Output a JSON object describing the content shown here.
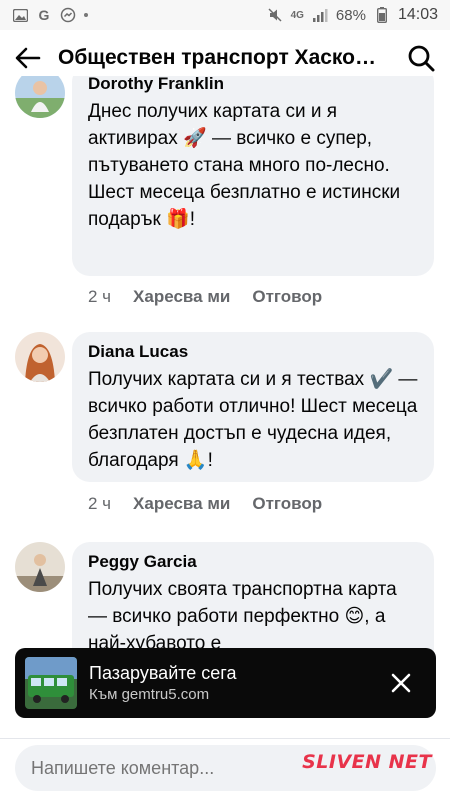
{
  "status_bar": {
    "battery": "68%",
    "time": "14:03",
    "network": "4G"
  },
  "header": {
    "title": "Обществен транспорт Хаско…"
  },
  "comments": [
    {
      "author": "Dorothy Franklin",
      "text": "Днес получих картата си и я активирах 🚀 — всичко е супер, пътуването стана много по-лесно. Шест месеца безплатно е истински подарък 🎁!",
      "time_ago": "2 ч",
      "like_label": "Харесва ми",
      "reply_label": "Отговор"
    },
    {
      "author": "Diana Lucas",
      "text": "Получих картата си и я тествах ✔️ — всичко работи отлично! Шест месеца безплатен достъп е чудесна идея, благодаря 🙏!",
      "time_ago": "2 ч",
      "like_label": "Харесва ми",
      "reply_label": "Отговор"
    },
    {
      "author": "Peggy Garcia",
      "text": "Получих своята транспортна карта — всичко работи перфектно 😊, а най-хубавото е",
      "time_ago": "",
      "like_label": "",
      "reply_label": ""
    }
  ],
  "ad": {
    "title": "Пазарувайте сега",
    "link": "Към gemtru5.com"
  },
  "composer": {
    "placeholder": "Напишете коментар..."
  },
  "watermark": {
    "text": "SLIVEN NET"
  },
  "icons": [
    "image-icon",
    "google-icon",
    "messenger-icon",
    "mute-icon",
    "signal-icon",
    "back-arrow-icon",
    "search-icon",
    "close-icon"
  ],
  "colors": {
    "bubble": "#f0f2f5",
    "action_text": "#65676b",
    "ad_background": "#0a0a0a",
    "watermark": "#e8334a"
  }
}
